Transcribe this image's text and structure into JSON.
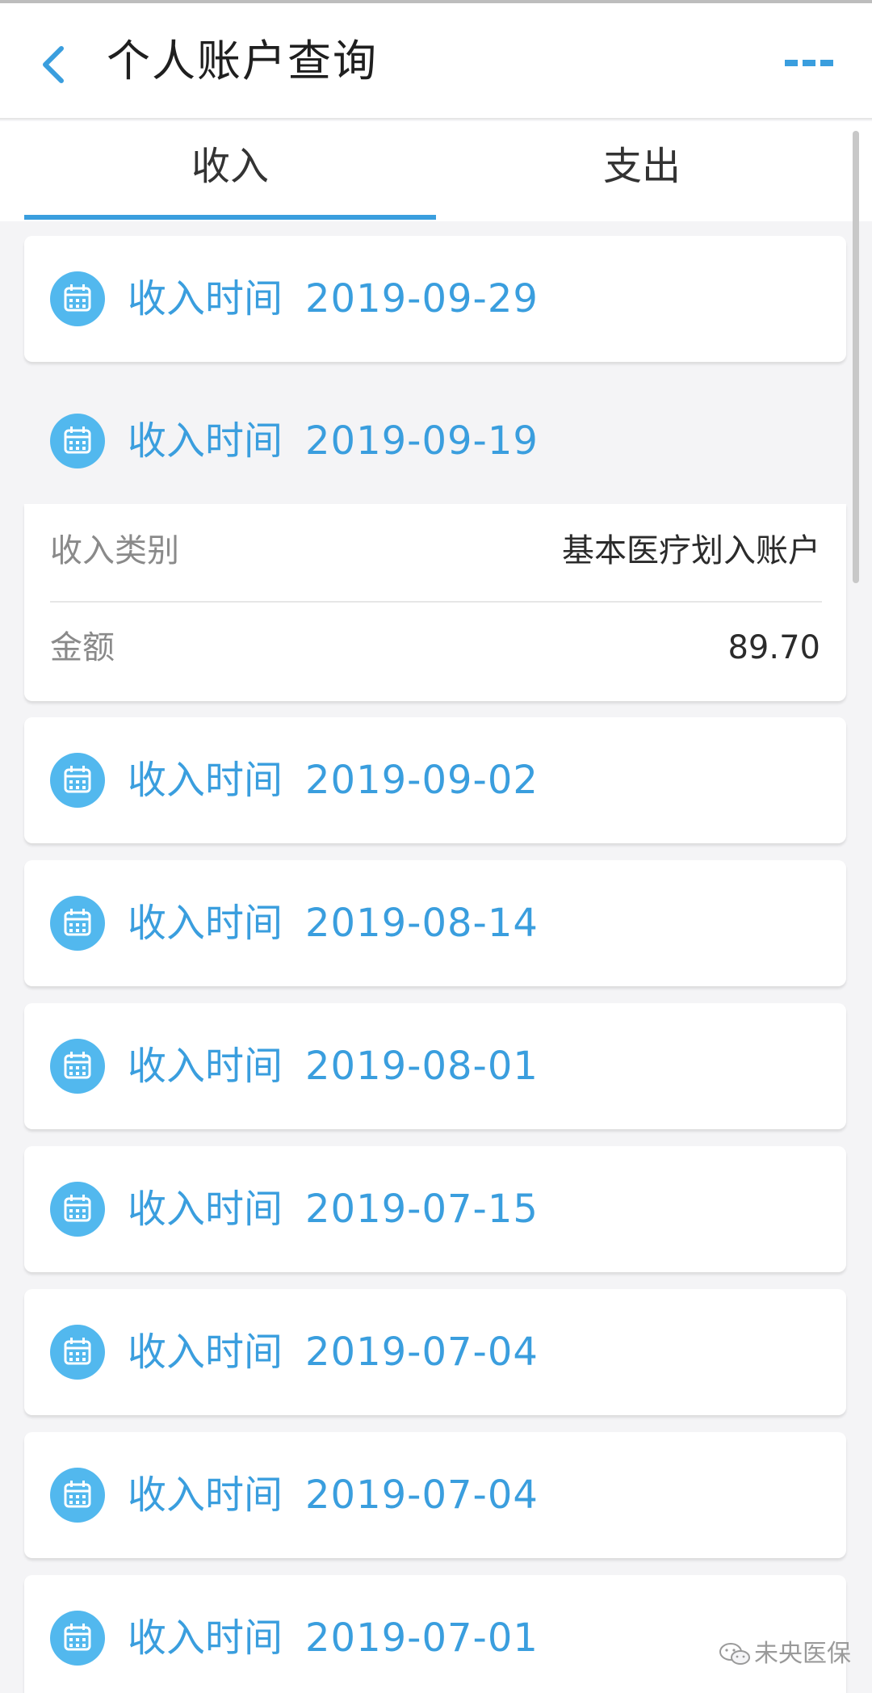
{
  "header": {
    "title": "个人账户查询",
    "back_icon": "chevron-left-icon",
    "more_icon": "more-dots-icon"
  },
  "tabs": [
    {
      "label": "收入",
      "active": true
    },
    {
      "label": "支出",
      "active": false
    }
  ],
  "records": [
    {
      "label": "收入时间",
      "date": "2019-09-29",
      "expanded": false
    },
    {
      "label": "收入时间",
      "date": "2019-09-19",
      "expanded": true,
      "details": [
        {
          "label": "收入类别",
          "value": "基本医疗划入账户"
        },
        {
          "label": "金额",
          "value": "89.70"
        }
      ]
    },
    {
      "label": "收入时间",
      "date": "2019-09-02",
      "expanded": false
    },
    {
      "label": "收入时间",
      "date": "2019-08-14",
      "expanded": false
    },
    {
      "label": "收入时间",
      "date": "2019-08-01",
      "expanded": false
    },
    {
      "label": "收入时间",
      "date": "2019-07-15",
      "expanded": false
    },
    {
      "label": "收入时间",
      "date": "2019-07-04",
      "expanded": false
    },
    {
      "label": "收入时间",
      "date": "2019-07-04",
      "expanded": false
    },
    {
      "label": "收入时间",
      "date": "2019-07-01",
      "expanded": false
    }
  ],
  "watermark": {
    "text": "未央医保"
  },
  "colors": {
    "accent": "#3a9ede",
    "icon_bg": "#52b8ee",
    "background": "#f4f4f6"
  }
}
